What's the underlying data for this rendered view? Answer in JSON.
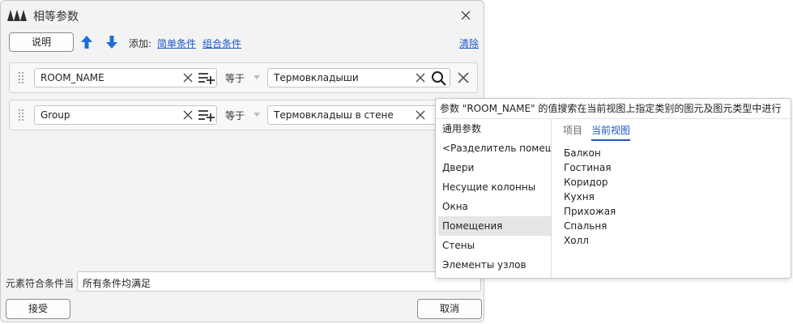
{
  "dialog": {
    "title": "相等参数",
    "explain_label": "说明",
    "add_label": "添加:",
    "simple_condition": "简单条件",
    "compound_condition": "组合条件",
    "clear_label": "清除"
  },
  "rules": [
    {
      "param": "ROOM_NAME",
      "operator": "等于",
      "value": "Термовкладыши"
    },
    {
      "param": "Group",
      "operator": "等于",
      "value": "Термовкладыш в стене"
    }
  ],
  "footer": {
    "match_label": "元素符合条件当",
    "match_value": "所有条件均满足",
    "accept_label": "接受",
    "cancel_label": "取消"
  },
  "popup": {
    "header": "参数 \"ROOM_NAME\" 的值搜索在当前视图上指定类别的图元及图元类型中进行",
    "categories": [
      "通用参数",
      "<Разделитель помещений>",
      "Двери",
      "Несущие колонны",
      "Окна",
      "Помещения",
      "Стены",
      "Элементы узлов"
    ],
    "selected_category": "Помещения",
    "tabs": [
      "项目",
      "当前视图"
    ],
    "active_tab": "当前视图",
    "values": [
      "Балкон",
      "Гостиная",
      "Коридор",
      "Кухня",
      "Прихожая",
      "Спальня",
      "Холл"
    ]
  },
  "colors": {
    "accent": "#1a57c9",
    "arrow_blue": "#1e6fd6",
    "dialog_bg": "#f3f3f3"
  },
  "icons": [
    "app-logo-icon",
    "close-icon",
    "move-up-icon",
    "move-down-icon",
    "drag-handle-icon",
    "clear-field-icon",
    "add-list-icon",
    "search-icon",
    "delete-rule-icon",
    "dropdown-caret-icon"
  ]
}
